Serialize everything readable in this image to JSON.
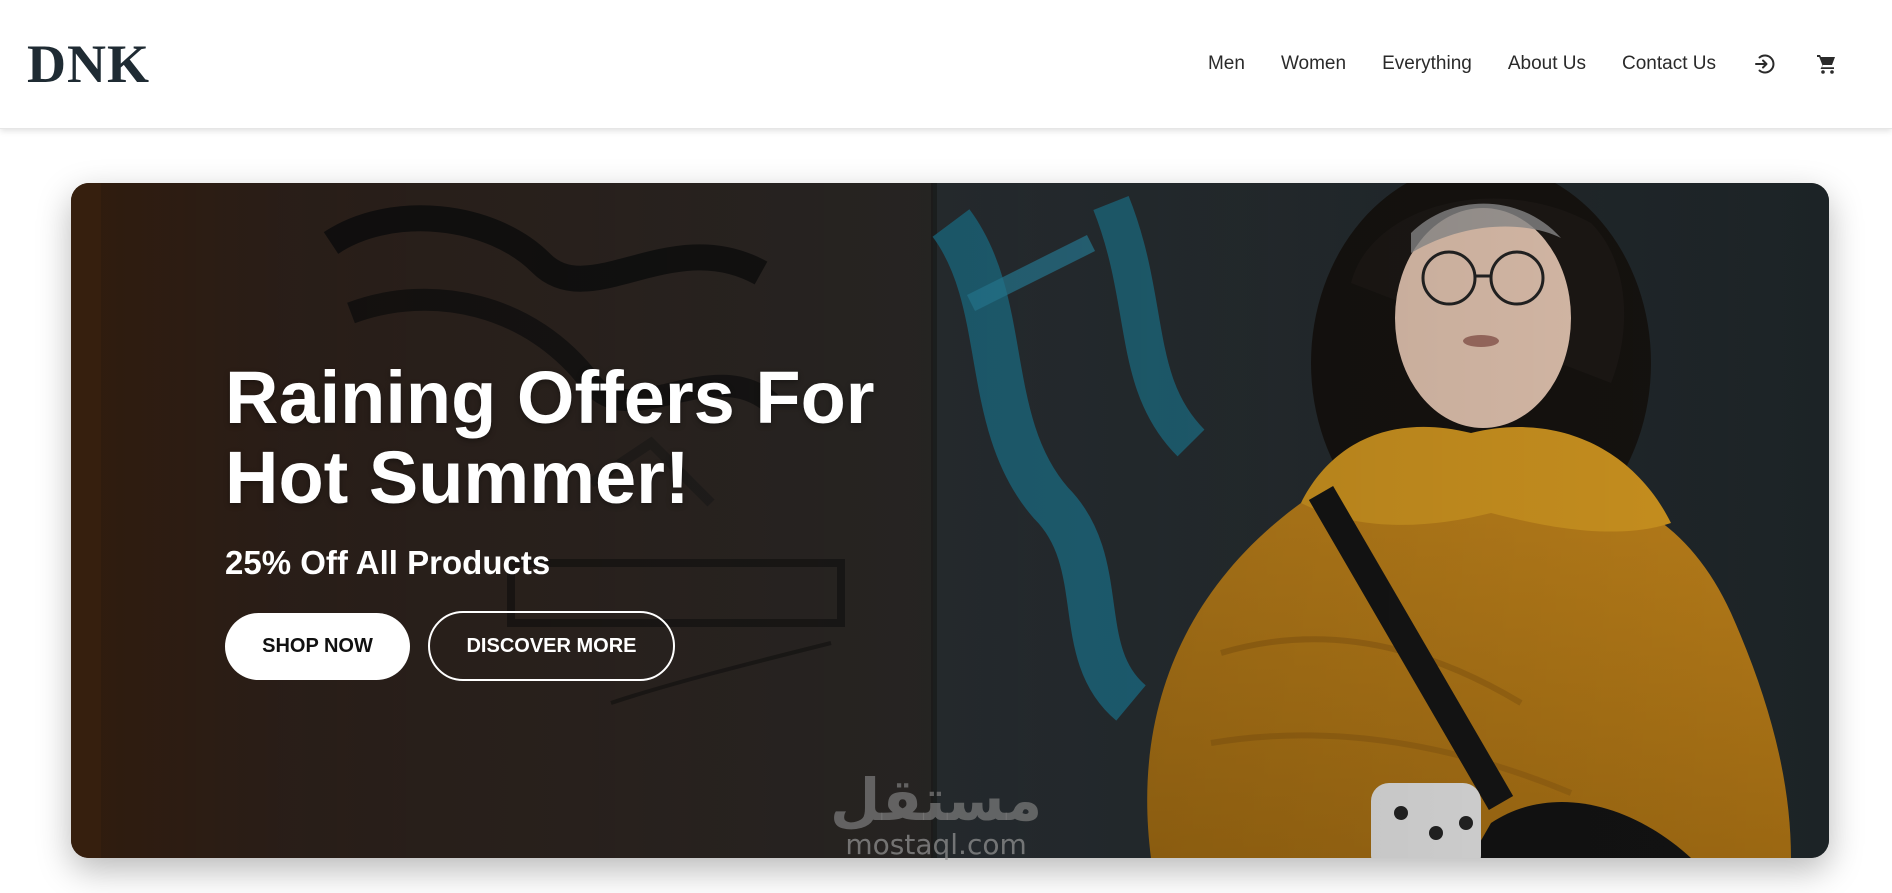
{
  "header": {
    "logo": "DNK",
    "nav": [
      "Men",
      "Women",
      "Everything",
      "About Us",
      "Contact Us"
    ],
    "icons": [
      "login-icon",
      "cart-icon"
    ]
  },
  "hero": {
    "title": "Raining Offers For Hot Summer!",
    "subtitle": "25% Off All Products",
    "primary_button": "SHOP NOW",
    "secondary_button": "DISCOVER MORE"
  },
  "watermark": {
    "arabic": "مستقل",
    "latin": "mostaql.com"
  },
  "colors": {
    "logo": "#1f2b33",
    "nav_text": "#2a2a2a",
    "jacket": "#c8901f",
    "graffiti_teal": "#1f6f86"
  }
}
